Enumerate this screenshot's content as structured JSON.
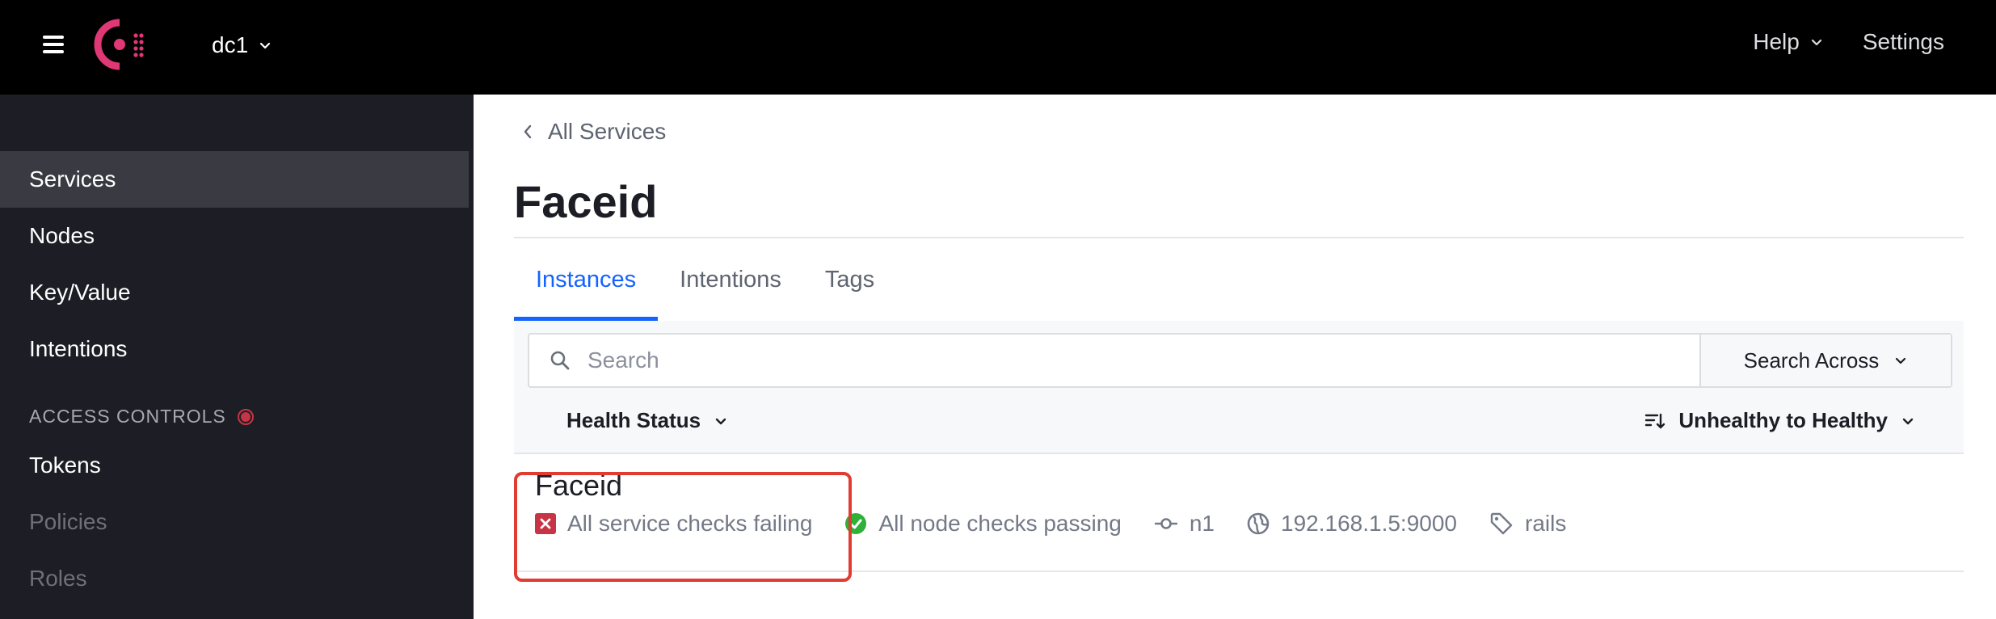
{
  "topbar": {
    "datacenter": "dc1",
    "help_label": "Help",
    "settings_label": "Settings",
    "brand_color": "#e03875"
  },
  "sidebar": {
    "items": [
      {
        "label": "Services",
        "active": true
      },
      {
        "label": "Nodes"
      },
      {
        "label": "Key/Value"
      },
      {
        "label": "Intentions"
      }
    ],
    "access_controls_heading": "ACCESS CONTROLS",
    "access_items": [
      {
        "label": "Tokens",
        "enabled": true
      },
      {
        "label": "Policies",
        "enabled": false
      },
      {
        "label": "Roles",
        "enabled": false
      }
    ]
  },
  "main": {
    "breadcrumb": "All Services",
    "title": "Faceid",
    "tabs": [
      {
        "label": "Instances",
        "active": true
      },
      {
        "label": "Intentions"
      },
      {
        "label": "Tags"
      }
    ],
    "search": {
      "placeholder": "Search",
      "search_across_label": "Search Across"
    },
    "filters": {
      "health_status_label": "Health Status",
      "sort_label": "Unhealthy to Healthy"
    },
    "instance": {
      "name": "Faceid",
      "service_checks": "All service checks failing",
      "node_checks": "All node checks passing",
      "node": "n1",
      "address": "192.168.1.5:9000",
      "tag": "rails"
    }
  },
  "colors": {
    "accent_blue": "#1563ff",
    "failing_red": "#c73445",
    "passing_green": "#2eb039",
    "highlight_outline": "#e03c31"
  }
}
